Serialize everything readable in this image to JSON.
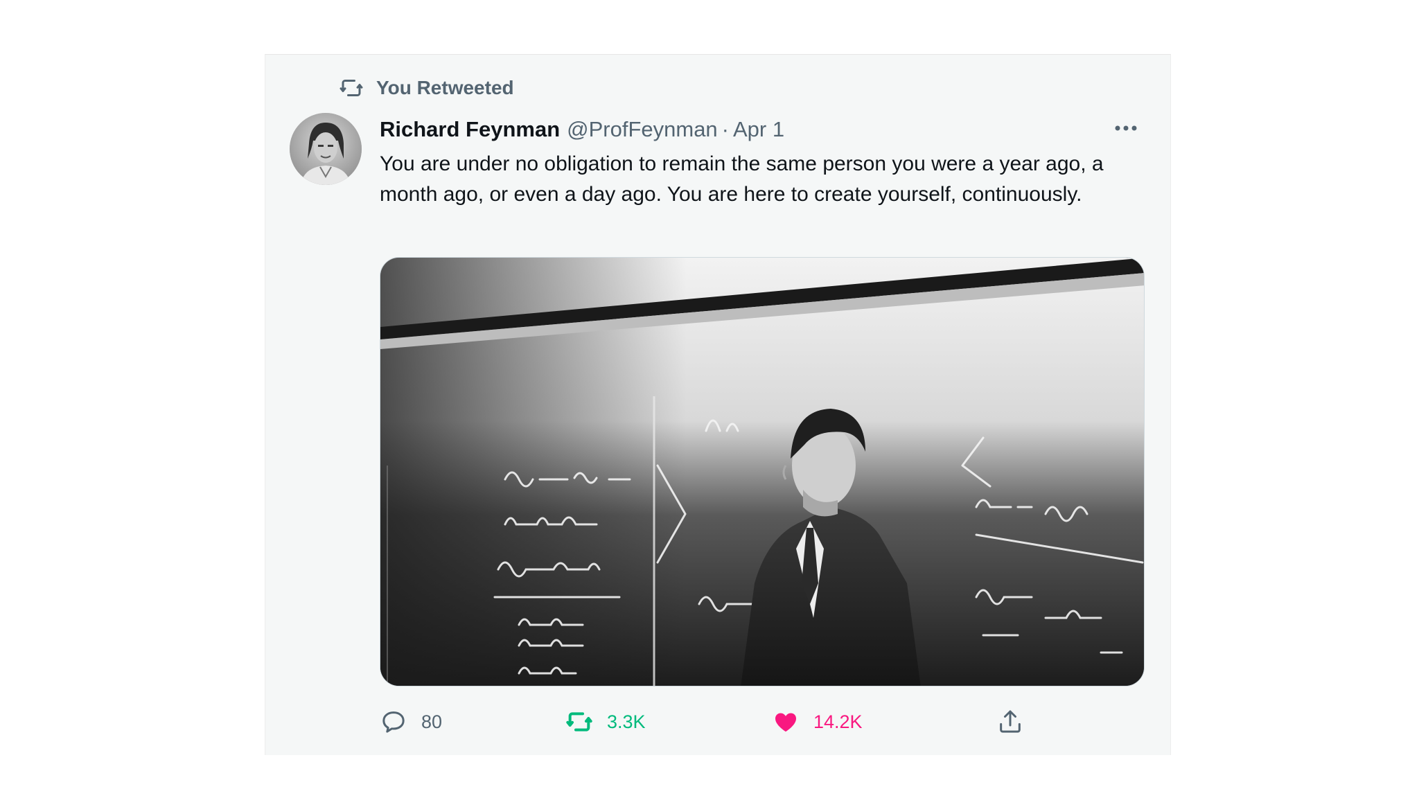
{
  "context": {
    "label": "You Retweeted",
    "icon": "retweet-icon"
  },
  "author": {
    "name": "Richard Feynman",
    "handle": "@ProfFeynman",
    "separator": "·",
    "date": "Apr 1",
    "avatar_icon": "avatar-photo"
  },
  "tweet": {
    "text": "You are under no obligation to remain the same person you were a year ago, a month ago, or even a day ago. You are here to create yourself, continuously."
  },
  "media": {
    "description_icon": "photo-of-man-at-chalkboard"
  },
  "actions": {
    "reply": {
      "icon": "reply-icon",
      "count": "80"
    },
    "retweet": {
      "icon": "retweet-icon",
      "count": "3.3K",
      "active": true,
      "color": "#00ba7c"
    },
    "like": {
      "icon": "heart-icon",
      "count": "14.2K",
      "active": true,
      "color": "#f91880"
    },
    "share": {
      "icon": "share-icon"
    }
  },
  "more_icon": "more-icon",
  "colors": {
    "card_background": "#f5f7f7",
    "text_primary": "#0f1419",
    "text_secondary": "#536471"
  }
}
